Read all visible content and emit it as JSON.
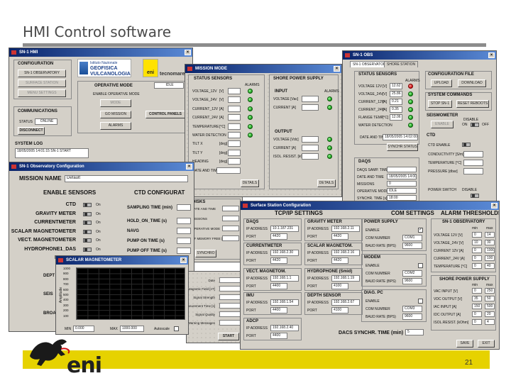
{
  "slide": {
    "title": "HMI Control software",
    "page_number": "21",
    "logo_text": "eni"
  },
  "win1": {
    "title": "SN-1 HMI",
    "config_group": "CONFIGURATION",
    "buttons": [
      "SN-1 OBSERVATORY",
      "SURFACE STATION",
      "MENU SETTINGS"
    ],
    "ingv_text": [
      "Istituto Nazionale",
      "GEOFISICA",
      "VULCANOLOGIA"
    ],
    "tecnomare": "tecnomare",
    "operative_mode": "OPERATIVE MODE",
    "mode_value": "IDLE",
    "enable_mode": "ENABLE OPERATIVE MODE",
    "mode_btn": "MODE",
    "go_mission": "GO MISSION",
    "control_panels": "CONTROL PANELS",
    "alarms": "ALARMS",
    "comms": "COMMUNICATIONS",
    "status": "STATUS",
    "online": "ONLINE",
    "disconnect": "DISCONNECT",
    "system_log": "SYSTEM LOG",
    "log_line": "18/05/2005 14:01:15  SN-1 START"
  },
  "win2": {
    "title": "MISSION MODE",
    "status_sensors": "STATUS SENSORS",
    "alarms": "ALARMS",
    "rows": [
      "VOLTAGE_12V",
      "VOLTAGE_24V",
      "CURRENT_12V",
      "CURRENT_24V",
      "TEMPERATURE",
      "WATER DETECTION",
      "TILT X",
      "TILT Y",
      "HEADING",
      "DATE AND TIME"
    ],
    "units": [
      "[V]",
      "[V]",
      "[A]",
      "[A]",
      "[°C]",
      "",
      "[deg]",
      "[deg]",
      "[deg]",
      ""
    ],
    "shore_ps": "SHORE POWER SUPPLY",
    "input": "INPUT",
    "voltage": "VOLTAGE [Vac]",
    "current": "CURRENT [A]",
    "output": "OUTPUT",
    "out_voltage": "VOLTAGE [Vdc]",
    "out_current": "CURRENT [A]",
    "isol": "ISOL. RESIST. [kOhm]",
    "details": "DETAILS",
    "disks": "DISKS",
    "disk_rows": [
      "DATE AND TIME",
      "MISSIONS",
      "OPERATIVE MODE",
      "OF MEMORY FREE [%]"
    ],
    "sync": "SYNCHRO"
  },
  "win3": {
    "title": "SN-1 OBS",
    "tabs": [
      "SN-1 OBSERVATORY",
      "SHORE STATION"
    ],
    "status_sensors": "STATUS SENSORS",
    "alarms": "ALARMS",
    "rows": [
      "VOLTAGE 12V",
      "VOLTAGE_24V",
      "CURRENT_12V",
      "CURRENT_24V",
      "FLANGE TEMP",
      "WATER DETECTION"
    ],
    "units": [
      "[V]",
      "[V]",
      "[A]",
      "[A]",
      "[°C]",
      ""
    ],
    "values": [
      "12.62",
      "25.86",
      "0.21",
      "0.35",
      "12.06",
      ""
    ],
    "date_time": "DATE AND TIME",
    "date_value": "18/05/2005 14:02:00",
    "sync_clock": "SYNCHR STATUS",
    "config_file": "CONFIGURATION FILE",
    "upload": "UPLOAD",
    "download": "DOWNLOAD",
    "system_cmds": "SYSTEM COMMANDS",
    "stop_sn1": "STOP SN-1",
    "reset_sn1": "RESET REBOOTS",
    "seismometer": "SEISMOMETER",
    "enable": "ENABLE",
    "disable": "DISABLE",
    "on": "ON",
    "off": "OFF",
    "ctd": "CTD",
    "ctd_enable": "CTD ENABLE",
    "conductivity": "CONDUCTIVITY [S/m]",
    "temperature": "TEMPERATURE [°C]",
    "pressure": "PRESSURE [dbar]",
    "daqs": "DAQS",
    "daqs_rows": [
      "DAQS SAMP. TIME",
      "DATE AND TIME",
      "MISSIONS",
      "OPERATIVE MODE",
      "SYNCHR. TIME [s]"
    ],
    "daqs_values": [
      "",
      "18/05/2005 14:00:00",
      "0",
      "IDLE",
      "18:00"
    ],
    "power_switch": "POWER SWITCH"
  },
  "win4": {
    "title": "SN-1 Observatory Configuration",
    "mission_name": "MISSION NAME",
    "mission_value": "Default",
    "enable_sensors": "ENABLE SENSORS",
    "sensors": [
      "CTD",
      "GRAVITY METER",
      "CURRENTMETER",
      "SCALAR MAGNETOMETER",
      "VECT. MAGNETOMETER",
      "HYDROPHONE1_DAS",
      "HYDROP"
    ],
    "on": "On",
    "ctd_config": "CTD CONFIGURAT",
    "sampling_time": "SAMPLING TIME (min)",
    "ctd_rows": [
      "HOLD_ON_TIME (s)",
      "NAVG",
      "PUMP ON TIME (s)",
      "PUMP OFF TIME (s)"
    ],
    "partial": [
      "DEPT",
      "SEIS",
      "BROA"
    ]
  },
  "win5": {
    "title": "SCALAR MAGNETOMETER",
    "ylabel": "Amplitude",
    "min_label": "MIN",
    "max_label": "MAX",
    "autoscale": "Autoscale",
    "min_value": "0.000",
    "max_value": "1000.000",
    "y_ticks": [
      "1000",
      "900",
      "800",
      "700",
      "600",
      "500",
      "400",
      "300",
      "200",
      "100"
    ]
  },
  "win6": {
    "rows": [
      "Date",
      "Magnetic Field [nT]",
      "Signal Strength",
      "Measurement Time [s]",
      "Signal Quality",
      "Warning Messages"
    ],
    "start": "START"
  },
  "win7": {
    "title": "Surface Station Configuration",
    "tcpip": "TCP/IP SETTINGS",
    "com": "COM SETTINGS",
    "alarm": "ALARM THRESHOLDS",
    "daqs": "DAQS",
    "ip_address": "IP ADDRESS",
    "port": "PORT",
    "daqs_ip": "10.1.187.231",
    "daqs_port": "4420",
    "gravity": "GRAVITY METER",
    "gravity_ip": "192.168.2.11",
    "gravity_port": "4420",
    "currentmeter": "CURRENTMETER",
    "cm_ip": "192.168.2.30",
    "cm_port": "4420",
    "scalar": "SCALAR MAGNETOM.",
    "scalar_ip": "192.168.2.16",
    "scalar_port": "4420",
    "vect": "VECT. MAGNETOM.",
    "vect_ip": "192.168.1.1",
    "vect_port": "4400",
    "hydro": "HYDROPHONE (Smid)",
    "hydro_ip": "192.168.1.19",
    "hydro_port": "4100",
    "imu": "IMU",
    "imu_ip": "192.168.1.54",
    "imu_port": "4400",
    "depth": "DEPTH SENSOR",
    "depth_ip": "192.168.2.67",
    "depth_port": "4100",
    "adcp": "ADCP",
    "adcp_ip": "192.168.2.40",
    "adcp_port": "4400",
    "power_supply": "POWER SUPPLY",
    "enable": "ENABLE",
    "com_number": "COM NUMBER",
    "baud_rate": "BAUD RATE (BPS)",
    "ps_com": "COM1",
    "ps_baud": "9600",
    "modem": "MODEM",
    "modem_com": "COM2",
    "modem_baud": "9600",
    "diag": "DIAG. PC",
    "diag_com": "COM3",
    "diag_baud": "9600",
    "sync_time": "DACS SYNCHR. TIME",
    "min": "(min)",
    "sync_value": "5",
    "sn1_obs": "SN-1 OBSERVATORY",
    "min_col": "min",
    "max_col": "max",
    "alarm_rows": [
      "VOLTAGE 12V [V]",
      "VOLTAGE_24V [V]",
      "CURRENT 12V [A]",
      "CURRENT_24V [A]",
      "TEMPERATURE [°C]"
    ],
    "alarm_min": [
      "0",
      "10",
      "0",
      "0",
      "0"
    ],
    "alarm_max": [
      "14",
      "30",
      "1000",
      "100",
      "40"
    ],
    "shore_ps": "SHORE POWER SUPPLY",
    "shore_rows": [
      "VAC INPUT [V]",
      "VDC OUTPUT [V]",
      "IAC INPUT [A]",
      "IDC OUTPUT [A]",
      "ISOL.RESIST. [kOhm]"
    ],
    "shore_min": [
      "0",
      "35",
      "150",
      "0",
      "0"
    ],
    "shore_max": [
      "250",
      "50",
      "500",
      "20",
      "4"
    ],
    "save": "SAVE",
    "exit": "EXIT"
  }
}
